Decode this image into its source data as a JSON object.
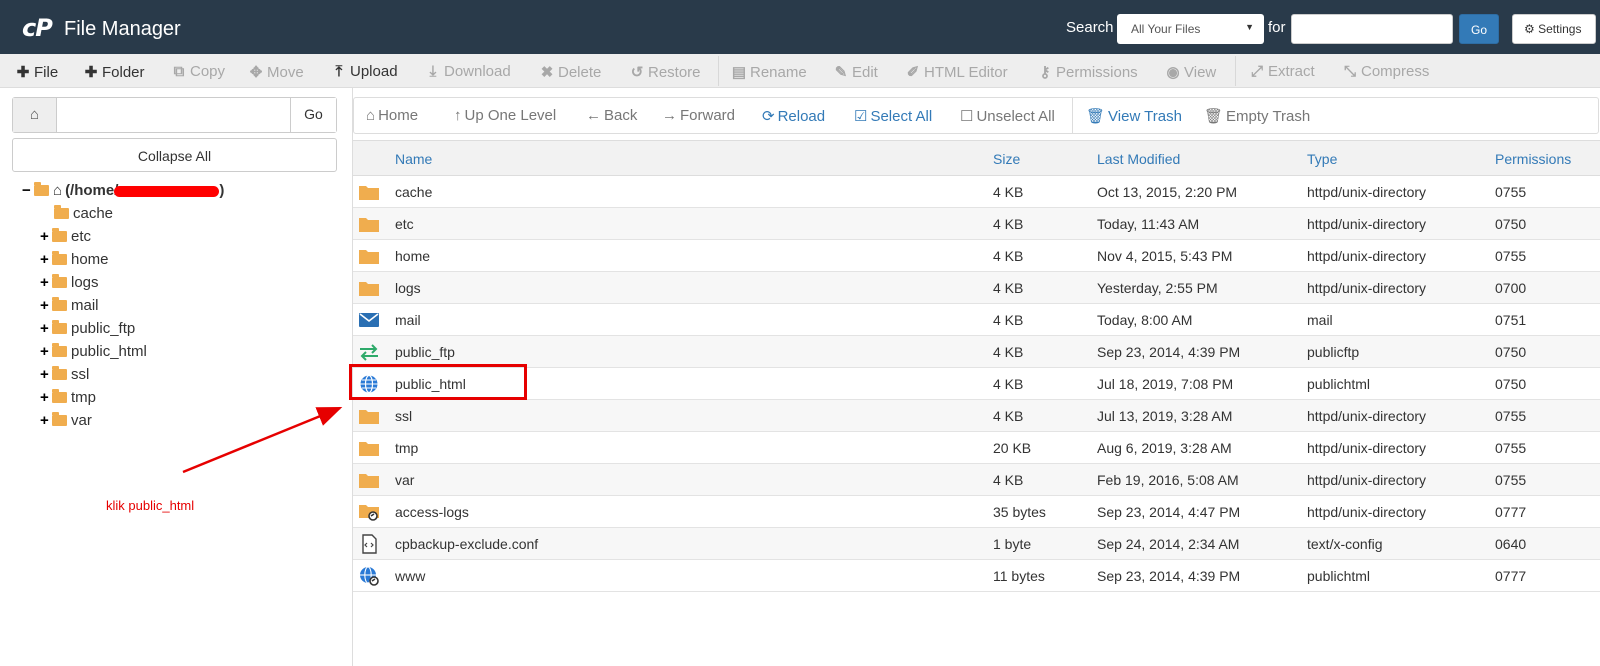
{
  "header": {
    "logo": "cP",
    "title": "File Manager",
    "search_label": "Search",
    "search_scope": "All Your Files",
    "for_label": "for",
    "search_value": "",
    "go_label": "Go",
    "settings_label": "Settings",
    "background_color": "#293a4a",
    "accent_color": "#337ab7"
  },
  "toolbar": {
    "file": "File",
    "folder": "Folder",
    "copy": "Copy",
    "move": "Move",
    "upload": "Upload",
    "download": "Download",
    "delete": "Delete",
    "restore": "Restore",
    "rename": "Rename",
    "edit": "Edit",
    "html_editor": "HTML Editor",
    "permissions": "Permissions",
    "view": "View",
    "extract": "Extract",
    "compress": "Compress"
  },
  "left": {
    "path_value": "",
    "go_label": "Go",
    "collapse_all": "Collapse All",
    "root_label": "(/home/",
    "root_close": ")",
    "tree": [
      {
        "label": "cache",
        "toggle": ""
      },
      {
        "label": "etc",
        "toggle": "+"
      },
      {
        "label": "home",
        "toggle": "+"
      },
      {
        "label": "logs",
        "toggle": "+"
      },
      {
        "label": "mail",
        "toggle": "+"
      },
      {
        "label": "public_ftp",
        "toggle": "+"
      },
      {
        "label": "public_html",
        "toggle": "+"
      },
      {
        "label": "ssl",
        "toggle": "+"
      },
      {
        "label": "tmp",
        "toggle": "+"
      },
      {
        "label": "var",
        "toggle": "+"
      }
    ],
    "annotation": "klik public_html"
  },
  "nav": {
    "home": "Home",
    "up_one_level": "Up One Level",
    "back": "Back",
    "forward": "Forward",
    "reload": "Reload",
    "select_all": "Select All",
    "unselect_all": "Unselect All",
    "view_trash": "View Trash",
    "empty_trash": "Empty Trash"
  },
  "table": {
    "columns": {
      "name": "Name",
      "size": "Size",
      "last_modified": "Last Modified",
      "type": "Type",
      "permissions": "Permissions"
    },
    "rows": [
      {
        "icon": "folder-icon",
        "name": "cache",
        "size": "4 KB",
        "modified": "Oct 13, 2015, 2:20 PM",
        "type": "httpd/unix-directory",
        "perms": "0755"
      },
      {
        "icon": "folder-icon",
        "name": "etc",
        "size": "4 KB",
        "modified": "Today, 11:43 AM",
        "type": "httpd/unix-directory",
        "perms": "0750"
      },
      {
        "icon": "folder-icon",
        "name": "home",
        "size": "4 KB",
        "modified": "Nov 4, 2015, 5:43 PM",
        "type": "httpd/unix-directory",
        "perms": "0755"
      },
      {
        "icon": "folder-icon",
        "name": "logs",
        "size": "4 KB",
        "modified": "Yesterday, 2:55 PM",
        "type": "httpd/unix-directory",
        "perms": "0700"
      },
      {
        "icon": "mail-icon",
        "name": "mail",
        "size": "4 KB",
        "modified": "Today, 8:00 AM",
        "type": "mail",
        "perms": "0751"
      },
      {
        "icon": "transfer-icon",
        "name": "public_ftp",
        "size": "4 KB",
        "modified": "Sep 23, 2014, 4:39 PM",
        "type": "publicftp",
        "perms": "0750"
      },
      {
        "icon": "globe-icon",
        "name": "public_html",
        "size": "4 KB",
        "modified": "Jul 18, 2019, 7:08 PM",
        "type": "publichtml",
        "perms": "0750"
      },
      {
        "icon": "folder-icon",
        "name": "ssl",
        "size": "4 KB",
        "modified": "Jul 13, 2019, 3:28 AM",
        "type": "httpd/unix-directory",
        "perms": "0755"
      },
      {
        "icon": "folder-icon",
        "name": "tmp",
        "size": "20 KB",
        "modified": "Aug 6, 2019, 3:28 AM",
        "type": "httpd/unix-directory",
        "perms": "0755"
      },
      {
        "icon": "folder-icon",
        "name": "var",
        "size": "4 KB",
        "modified": "Feb 19, 2016, 5:08 AM",
        "type": "httpd/unix-directory",
        "perms": "0755"
      },
      {
        "icon": "folder-link-icon",
        "name": "access-logs",
        "size": "35 bytes",
        "modified": "Sep 23, 2014, 4:47 PM",
        "type": "httpd/unix-directory",
        "perms": "0777"
      },
      {
        "icon": "code-file-icon",
        "name": "cpbackup-exclude.conf",
        "size": "1 byte",
        "modified": "Sep 24, 2014, 2:34 AM",
        "type": "text/x-config",
        "perms": "0640"
      },
      {
        "icon": "globe-link-icon",
        "name": "www",
        "size": "11 bytes",
        "modified": "Sep 23, 2014, 4:39 PM",
        "type": "publichtml",
        "perms": "0777"
      }
    ]
  }
}
